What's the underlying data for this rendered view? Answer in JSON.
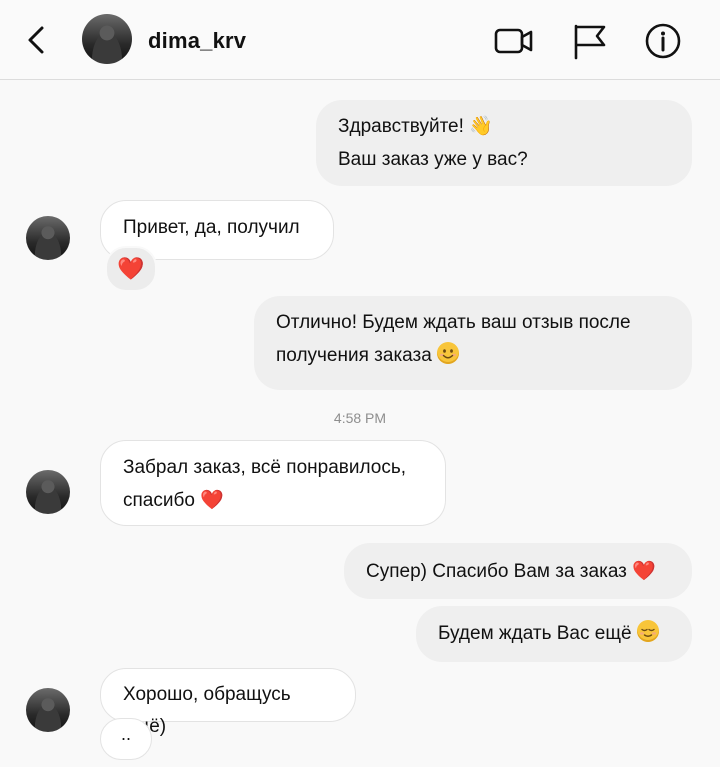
{
  "header": {
    "username": "dima_krv",
    "icons": [
      "back-chevron-icon",
      "video-call-icon",
      "report-flag-icon",
      "info-icon"
    ]
  },
  "messages": [
    {
      "side": "out",
      "lines": [
        "Здравствуйте! 👋",
        "Ваш заказ уже у вас?"
      ]
    },
    {
      "side": "in",
      "text": "Привет, да, получил",
      "reaction": "❤️"
    },
    {
      "side": "out",
      "lines": [
        "Отлично! Будем ждать ваш отзыв после",
        "получения заказа"
      ],
      "emoji": "smiling-face"
    },
    {
      "side": "in",
      "lines": [
        "Забрал заказ, всё понравилось,",
        "спасибо"
      ],
      "emoji": "❤️"
    },
    {
      "side": "out",
      "text": "Супер) Спасибо Вам за заказ",
      "emoji": "❤️"
    },
    {
      "side": "out",
      "text": "Будем ждать Вас ещё",
      "emoji": "relieved-face"
    },
    {
      "side": "in",
      "text": "Хорошо, обращусь ещё)"
    }
  ],
  "timestamp": "4:58 PM",
  "typing_indicator": "..",
  "colors": {
    "outgoing_bubble": "#efefef",
    "incoming_bubble": "#ffffff",
    "heart": "#e8192c",
    "timestamp": "#8e8e8e"
  }
}
